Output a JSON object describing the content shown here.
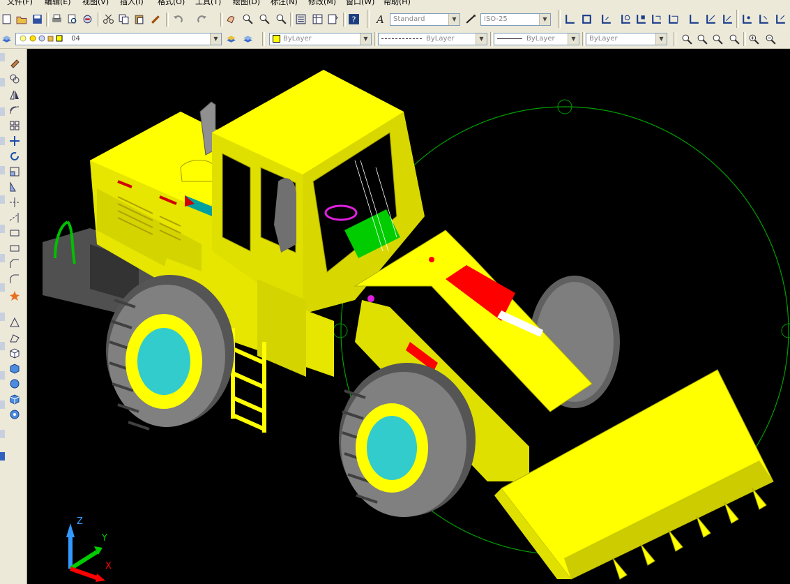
{
  "menu": [
    "文件(F)",
    "编辑(E)",
    "视图(V)",
    "插入(I)",
    "格式(O)",
    "工具(T)",
    "绘图(D)",
    "标注(N)",
    "修改(M)",
    "窗口(W)",
    "帮助(H)"
  ],
  "styles": {
    "text_style": "Standard",
    "dim_style": "ISO-25"
  },
  "layers": {
    "current_layer": "04",
    "color": "ByLayer",
    "linetype": "ByLayer",
    "lineweight": "ByLayer",
    "plot_style": "ByLayer"
  },
  "ucs_icon": {
    "z": "Z",
    "y": "Y",
    "x": "X"
  },
  "colors": {
    "background": "#000000",
    "model_body": "#ffff00",
    "hub": "#33cccc",
    "tire": "#808080",
    "cylinder": "#ff0000",
    "circle": "#00a000",
    "ucs_z": "#3399ff",
    "ucs_y": "#00cc00",
    "ucs_x": "#ff0000"
  },
  "icons": {
    "toolbar1": [
      "new-icon",
      "open-icon",
      "save-icon",
      "print-icon",
      "preview-icon",
      "publish-icon",
      "cut-icon",
      "copy-icon",
      "paste-icon",
      "match-icon",
      "undo-icon",
      "redo-icon",
      "pan-icon",
      "zoom-realtime-icon",
      "zoom-window-icon",
      "zoom-previous-icon",
      "properties-icon",
      "design-center-icon",
      "tool-palette-icon",
      "help-icon",
      "text-style-icon",
      "dim-style-icon",
      "ucs-icons"
    ],
    "palette": [
      "erase-icon",
      "copy-object-icon",
      "mirror-icon",
      "offset-icon",
      "array-icon",
      "move-icon",
      "rotate-icon",
      "scale-icon",
      "stretch-icon",
      "trim-icon",
      "extend-icon",
      "break-icon",
      "chamfer-icon",
      "fillet-icon",
      "explode-icon"
    ]
  }
}
